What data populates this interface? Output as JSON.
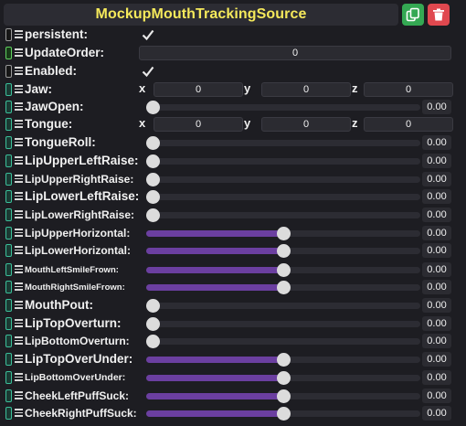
{
  "header": {
    "title": "MockupMouthTrackingSource",
    "duplicate_icon": "duplicate-icon",
    "delete_icon": "trash-icon"
  },
  "colors": {
    "title": "#f5e95b",
    "slider_fill": "#6b3fa0",
    "duplicate_button": "#34a853",
    "delete_button": "#e0484f"
  },
  "fields": {
    "persistent": {
      "label": "persistent:",
      "checked": true
    },
    "update_order": {
      "label": "UpdateOrder:",
      "value": "0"
    },
    "enabled": {
      "label": "Enabled:",
      "checked": true
    },
    "jaw": {
      "label": "Jaw:",
      "x_label": "x",
      "y_label": "y",
      "z_label": "z",
      "x": "0",
      "y": "0",
      "z": "0"
    },
    "tongue": {
      "label": "Tongue:",
      "x_label": "x",
      "y_label": "y",
      "z_label": "z",
      "x": "0",
      "y": "0",
      "z": "0"
    }
  },
  "sliders": [
    {
      "label": "JawOpen:",
      "value": "0.00",
      "position": 0,
      "range": "0..1"
    },
    {
      "label": "TongueRoll:",
      "value": "0.00",
      "position": 0,
      "range": "0..1"
    },
    {
      "label": "LipUpperLeftRaise:",
      "value": "0.00",
      "position": 0,
      "range": "0..1"
    },
    {
      "label": "LipUpperRightRaise:",
      "value": "0.00",
      "position": 0,
      "range": "0..1"
    },
    {
      "label": "LipLowerLeftRaise:",
      "value": "0.00",
      "position": 0,
      "range": "0..1"
    },
    {
      "label": "LipLowerRightRaise:",
      "value": "0.00",
      "position": 0,
      "range": "0..1"
    },
    {
      "label": "LipUpperHorizontal:",
      "value": "0.00",
      "position": 0.5,
      "range": "-1..1"
    },
    {
      "label": "LipLowerHorizontal:",
      "value": "0.00",
      "position": 0.5,
      "range": "-1..1"
    },
    {
      "label": "MouthLeftSmileFrown:",
      "value": "0.00",
      "position": 0.5,
      "range": "-1..1"
    },
    {
      "label": "MouthRightSmileFrown:",
      "value": "0.00",
      "position": 0.5,
      "range": "-1..1"
    },
    {
      "label": "MouthPout:",
      "value": "0.00",
      "position": 0,
      "range": "0..1"
    },
    {
      "label": "LipTopOverturn:",
      "value": "0.00",
      "position": 0,
      "range": "0..1"
    },
    {
      "label": "LipBottomOverturn:",
      "value": "0.00",
      "position": 0,
      "range": "0..1"
    },
    {
      "label": "LipTopOverUnder:",
      "value": "0.00",
      "position": 0.5,
      "range": "-1..1"
    },
    {
      "label": "LipBottomOverUnder:",
      "value": "0.00",
      "position": 0.5,
      "range": "-1..1"
    },
    {
      "label": "CheekLeftPuffSuck:",
      "value": "0.00",
      "position": 0.5,
      "range": "-1..1"
    },
    {
      "label": "CheekRightPuffSuck:",
      "value": "0.00",
      "position": 0.5,
      "range": "-1..1"
    }
  ]
}
